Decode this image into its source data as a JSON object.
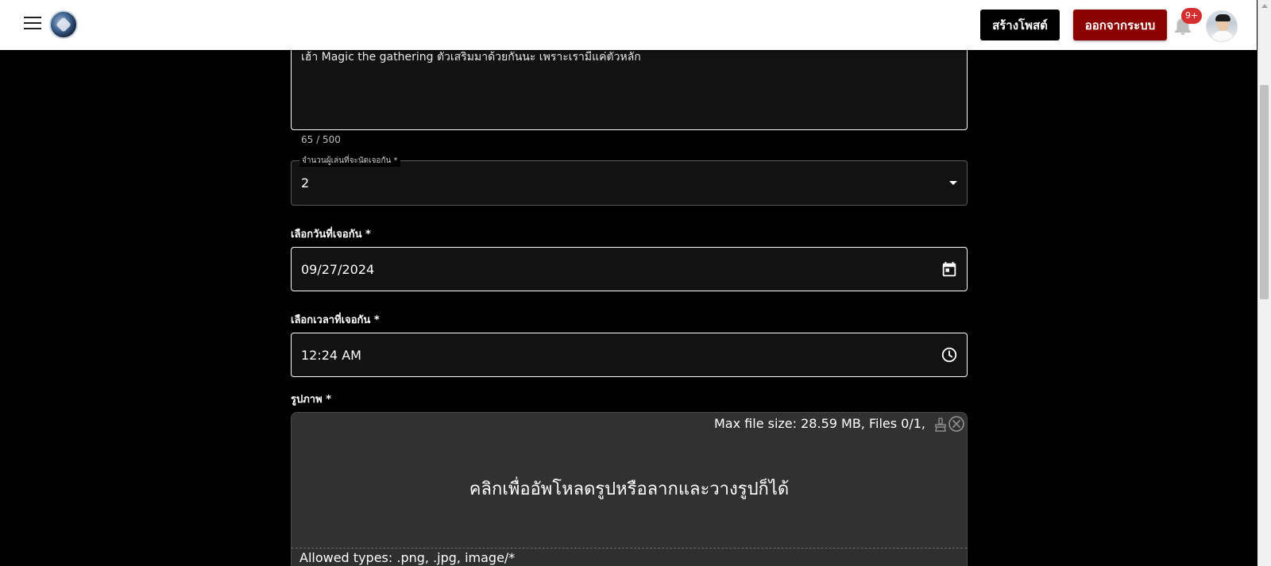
{
  "header": {
    "create_post_label": "สร้างโพสต์",
    "logout_label": "ออกจากระบบ",
    "notification_badge": "9+"
  },
  "form": {
    "description": {
      "value": "เฮ้า Magic the gathering ตัวเสริมมาด้วยกันนะ เพราะเรามีแค่ตัวหลัก",
      "counter": "65 / 500"
    },
    "players": {
      "label": "จำนวนผู้เล่นที่จะนัดเจอกัน *",
      "value": "2"
    },
    "date": {
      "label": "เลือกวันที่เจอกัน *",
      "value": "09/27/2024"
    },
    "time": {
      "label": "เลือกเวลาที่เจอกัน *",
      "value": "12:24 AM"
    },
    "image": {
      "label": "รูปภาพ *",
      "info": "Max file size: 28.59 MB, Files 0/1,",
      "prompt": "คลิกเพื่ออัพโหลดรูปหรือลากและวางรูปก็ได้",
      "allowed_types": "Allowed types: .png, .jpg, image/*"
    }
  },
  "colors": {
    "logout_bg": "#8b0000",
    "create_bg": "#000000",
    "badge_bg": "#d32f2f",
    "page_bg": "#000000",
    "dropzone_bg": "#313131"
  }
}
